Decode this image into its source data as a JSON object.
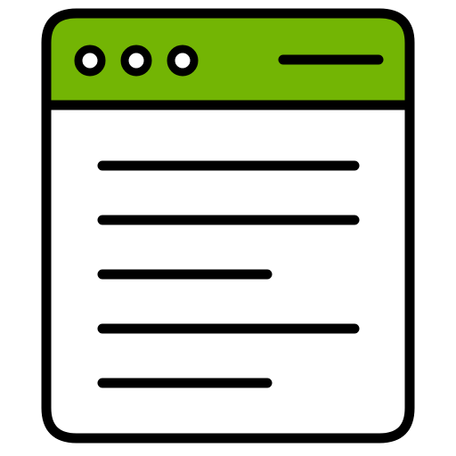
{
  "icon": {
    "name": "browser-window-document-icon",
    "colors": {
      "stroke": "#000000",
      "header_fill": "#73B504",
      "body_fill": "#ffffff"
    },
    "window_control_icons": [
      "circle-icon",
      "circle-icon",
      "circle-icon"
    ],
    "title_bar_line_icon": "line-icon",
    "content_line_count": 5
  }
}
